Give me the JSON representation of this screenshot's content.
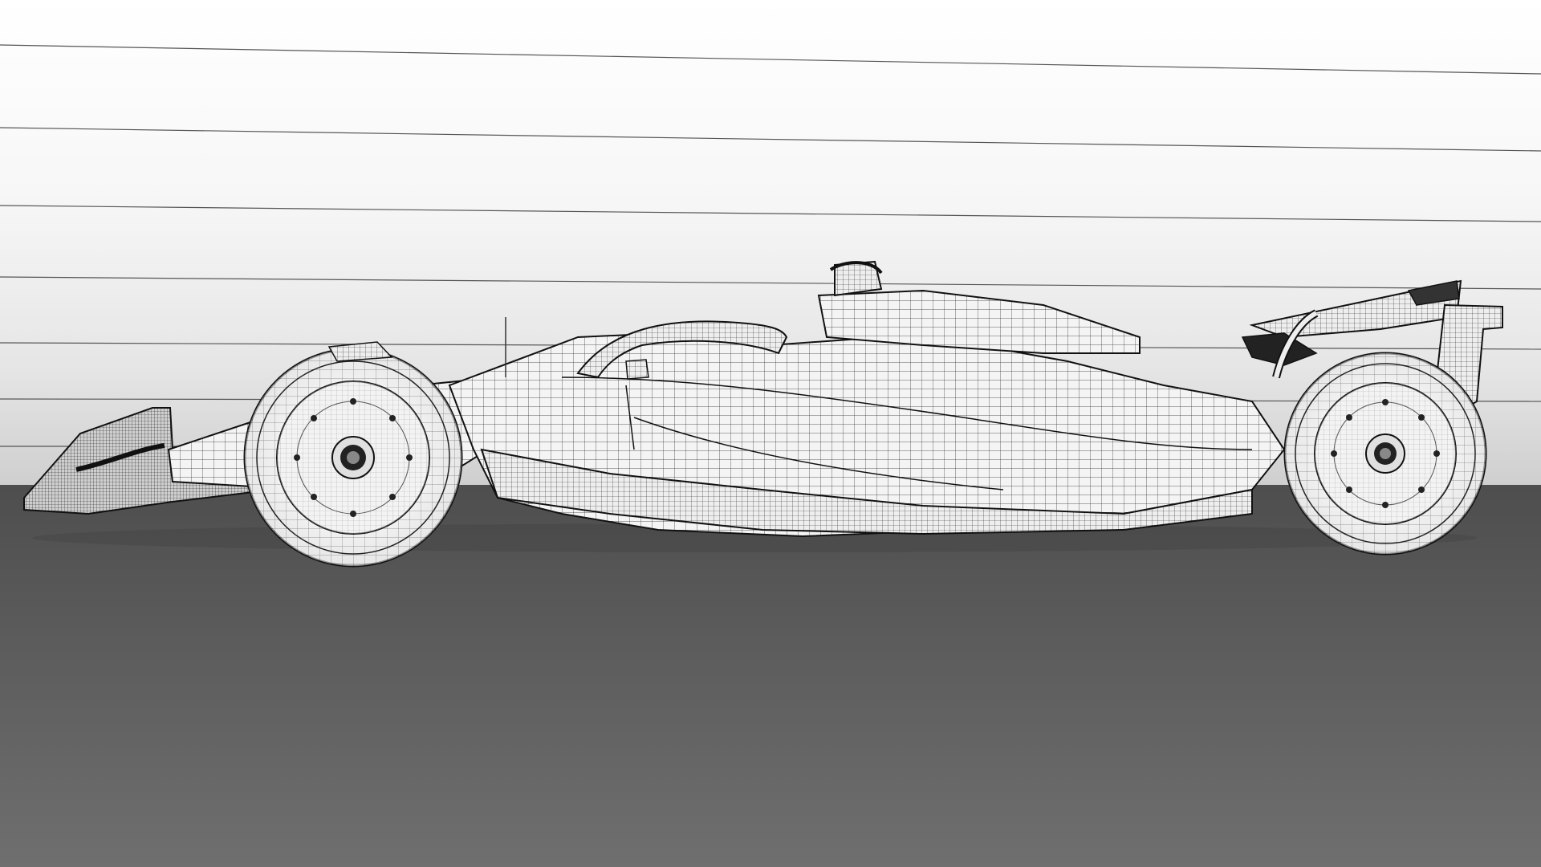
{
  "scene": {
    "subject": "formula-one-car-wireframe-render",
    "view": "side-profile",
    "backdrop_color": "#ffffff",
    "floor_color": "#5a5a5a",
    "car_body_color": "#f2f2f2",
    "mesh_line_color": "#1a1a1a",
    "guide_line_count": 7
  }
}
